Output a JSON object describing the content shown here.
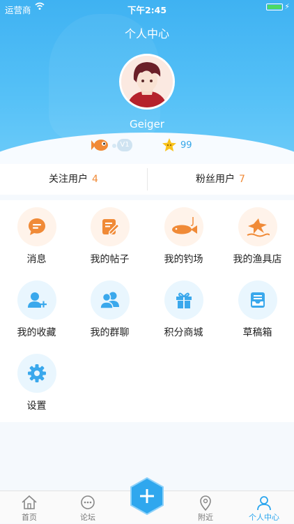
{
  "status_bar": {
    "carrier": "运营商",
    "time": "下午2:45"
  },
  "header": {
    "title": "个人中心",
    "username": "Geiger",
    "level": "V1",
    "points": "99"
  },
  "follow": {
    "following_label": "关注用户",
    "following_count": "4",
    "fans_label": "粉丝用户",
    "fans_count": "7"
  },
  "menu": [
    {
      "label": "消息",
      "icon": "message-icon"
    },
    {
      "label": "我的帖子",
      "icon": "edit-post-icon"
    },
    {
      "label": "我的钓场",
      "icon": "fishing-spot-icon"
    },
    {
      "label": "我的渔具店",
      "icon": "tackle-shop-icon"
    },
    {
      "label": "我的收藏",
      "icon": "add-user-icon"
    },
    {
      "label": "我的群聊",
      "icon": "group-chat-icon"
    },
    {
      "label": "积分商城",
      "icon": "gift-icon"
    },
    {
      "label": "草稿箱",
      "icon": "draft-box-icon"
    },
    {
      "label": "设置",
      "icon": "gear-icon"
    }
  ],
  "tabbar": [
    {
      "label": "首页",
      "icon": "home-icon"
    },
    {
      "label": "论坛",
      "icon": "forum-icon"
    },
    {
      "label": "",
      "icon": "plus-icon"
    },
    {
      "label": "附近",
      "icon": "location-icon"
    },
    {
      "label": "个人中心",
      "icon": "profile-icon"
    }
  ],
  "colors": {
    "accent_blue": "#29a5ee",
    "accent_orange": "#f08a37"
  }
}
